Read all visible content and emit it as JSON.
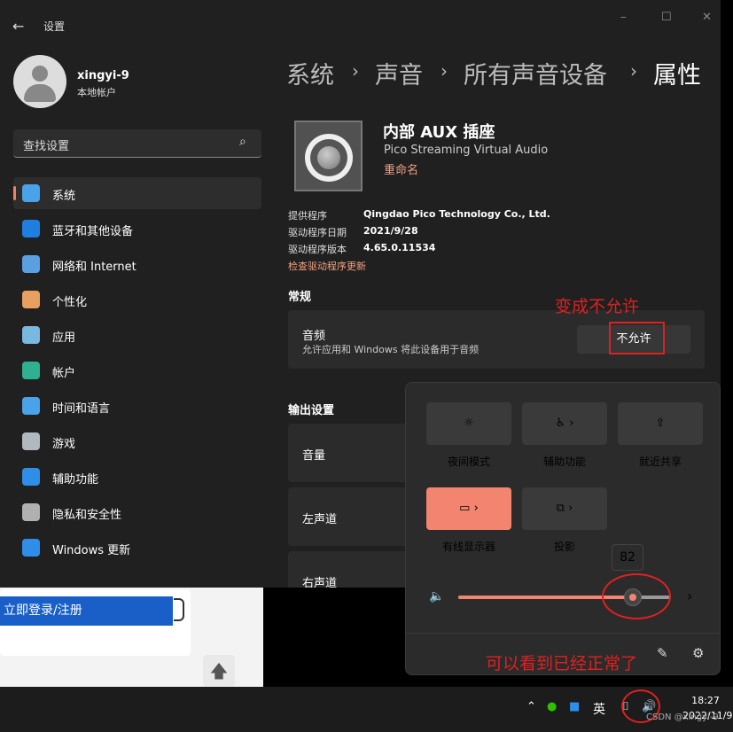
{
  "window": {
    "title": "设置",
    "back_icon": "back-arrow-icon",
    "controls": [
      "–",
      "☐",
      "✕"
    ]
  },
  "profile": {
    "name": "xingyi-9",
    "type": "本地帐户"
  },
  "search": {
    "placeholder": "查找设置",
    "icon": "search-icon"
  },
  "nav": [
    {
      "label": "系统",
      "icon": "monitor-icon",
      "color": "#4aa3e8",
      "selected": true
    },
    {
      "label": "蓝牙和其他设备",
      "icon": "bluetooth-icon",
      "color": "#1f7fe0"
    },
    {
      "label": "网络和 Internet",
      "icon": "wifi-icon",
      "color": "#5aa0e0"
    },
    {
      "label": "个性化",
      "icon": "brush-icon",
      "color": "#e8a060"
    },
    {
      "label": "应用",
      "icon": "apps-icon",
      "color": "#7ab8e0"
    },
    {
      "label": "帐户",
      "icon": "account-icon",
      "color": "#2fb090"
    },
    {
      "label": "时间和语言",
      "icon": "clock-globe-icon",
      "color": "#4aa3e8"
    },
    {
      "label": "游戏",
      "icon": "gamepad-icon",
      "color": "#b0b8c0"
    },
    {
      "label": "辅助功能",
      "icon": "accessibility-icon",
      "color": "#2f8fe8"
    },
    {
      "label": "隐私和安全性",
      "icon": "shield-icon",
      "color": "#b0b0b0"
    },
    {
      "label": "Windows 更新",
      "icon": "update-icon",
      "color": "#2f8fe8"
    }
  ],
  "breadcrumb": [
    "系统",
    "声音",
    "所有声音设备",
    "属性"
  ],
  "device": {
    "name": "内部 AUX 插座",
    "subtitle": "Pico Streaming Virtual Audio",
    "rename": "重命名",
    "info": [
      {
        "key": "提供程序",
        "value": "Qingdao Pico Technology Co., Ltd."
      },
      {
        "key": "驱动程序日期",
        "value": "2021/9/28"
      },
      {
        "key": "驱动程序版本",
        "value": "4.65.0.11534"
      }
    ],
    "check_driver": "检查驱动程序更新"
  },
  "general": {
    "heading": "常规",
    "audio_title": "音频",
    "audio_desc": "允许应用和 Windows 将此设备用于音频",
    "button": "不允许"
  },
  "output": {
    "heading": "输出设置",
    "rows": [
      "音量",
      "左声道",
      "右声道"
    ]
  },
  "annotations": {
    "top": "变成不允许",
    "bottom": "可以看到已经正常了"
  },
  "quick_settings": {
    "tiles": [
      {
        "label": "夜间模式",
        "icon": "brightness-icon",
        "on": false,
        "arrow": false
      },
      {
        "label": "辅助功能",
        "icon": "accessibility-icon",
        "on": false,
        "arrow": true
      },
      {
        "label": "就近共享",
        "icon": "share-icon",
        "on": false,
        "arrow": false
      },
      {
        "label": "有线显示器",
        "icon": "cast-icon",
        "on": true,
        "arrow": true
      },
      {
        "label": "投影",
        "icon": "project-icon",
        "on": false,
        "arrow": true
      }
    ],
    "volume": {
      "value": 82,
      "tooltip": "82",
      "accent": "#f28470"
    },
    "footer_icons": [
      "edit-icon",
      "settings-icon"
    ]
  },
  "background": {
    "login": "立即登录/注册"
  },
  "taskbar": {
    "ime": "英",
    "time": "18:27",
    "date": "2022/11/9",
    "watermark": "CSDN @xingyi-9"
  }
}
